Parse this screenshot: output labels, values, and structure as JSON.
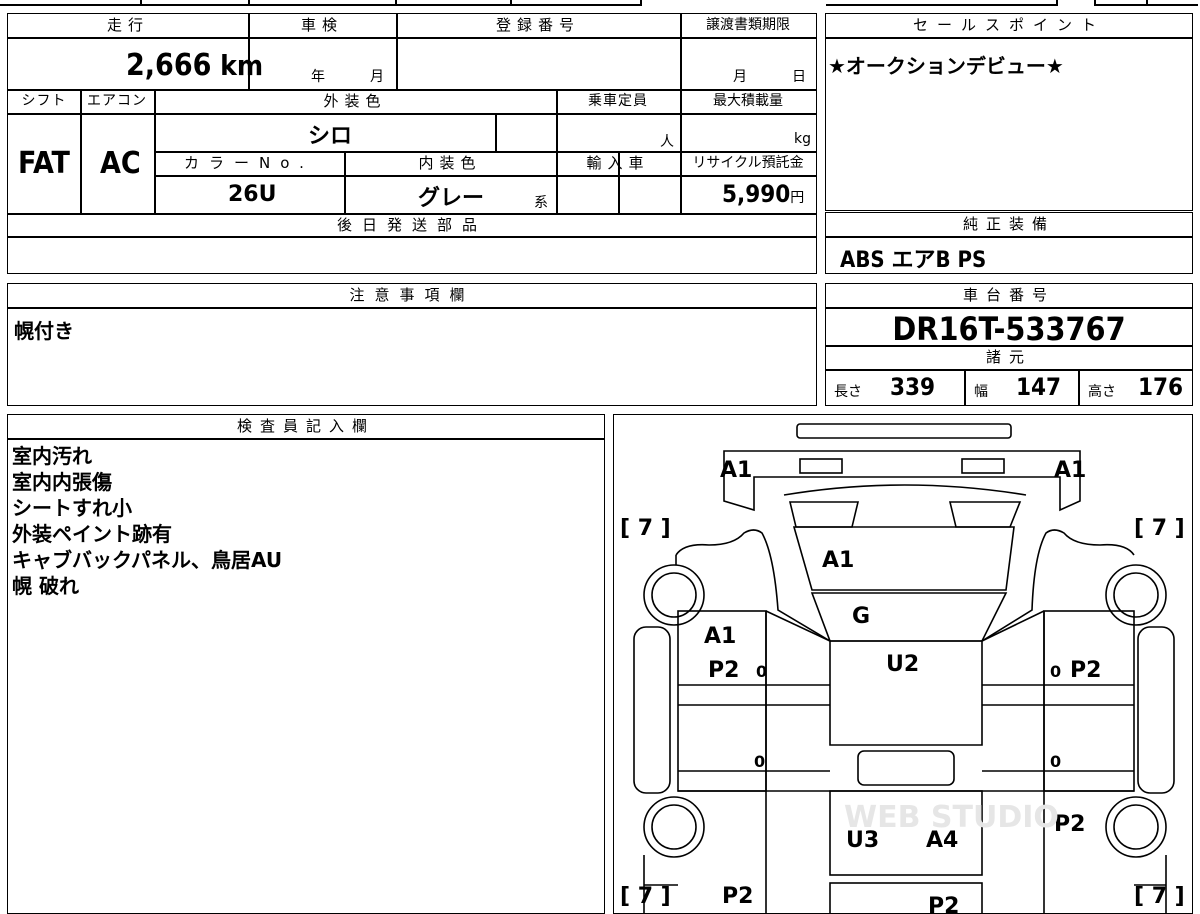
{
  "top_strip": {},
  "mileage": {
    "label": "走行",
    "value": "2,666",
    "unit": "km"
  },
  "inspection": {
    "label": "車検",
    "year": "年",
    "month": "月"
  },
  "registration": {
    "label": "登録番号",
    "value": ""
  },
  "transfer_deadline": {
    "label": "譲渡書類期限",
    "month": "月",
    "day": "日"
  },
  "sales_point": {
    "label": "セールスポイント",
    "text": "★オークションデビュー★"
  },
  "shift": {
    "label": "シフト",
    "value": "FAT"
  },
  "aircon": {
    "label": "エアコン",
    "value": "AC"
  },
  "exterior_color": {
    "label": "外装色",
    "value": "シロ"
  },
  "capacity": {
    "label": "乗車定員",
    "unit": "人"
  },
  "max_load": {
    "label": "最大積載量",
    "unit": "kg"
  },
  "color_no": {
    "label": "カラーNo.",
    "value": "26U"
  },
  "interior_color": {
    "label": "内装色",
    "value": "グレー",
    "suffix": "系"
  },
  "import": {
    "label": "輸入車"
  },
  "recycle_fee": {
    "label": "リサイクル預託金",
    "value": "5,990",
    "unit": "円"
  },
  "later_parts": {
    "label": "後日発送部品",
    "value": ""
  },
  "factory_equipment": {
    "label": "純正装備",
    "value": "ABS エアB PS"
  },
  "notes": {
    "label": "注意事項欄",
    "text": "幌付き"
  },
  "chassis": {
    "label": "車台番号",
    "value": "DR16T-533767"
  },
  "specs": {
    "label": "諸元",
    "length_label": "長さ",
    "length": "339",
    "width_label": "幅",
    "width": "147",
    "height_label": "高さ",
    "height": "176"
  },
  "inspector": {
    "label": "検査員記入欄",
    "lines": [
      "室内汚れ",
      "室内内張傷",
      "シートすれ小",
      "外装ペイント跡有",
      "キャブバックパネル、鳥居AU",
      "幌 破れ"
    ]
  },
  "diagram": {
    "marks": [
      {
        "id": "front-left-corner",
        "text": "A1"
      },
      {
        "id": "front-right-corner",
        "text": "A1"
      },
      {
        "id": "hood",
        "text": "A1"
      },
      {
        "id": "windshield",
        "text": "G"
      },
      {
        "id": "roof",
        "text": "U2"
      },
      {
        "id": "left-door",
        "text": "A1"
      },
      {
        "id": "left-door-2",
        "text": "P2"
      },
      {
        "id": "right-door",
        "text": "P2"
      },
      {
        "id": "bed-floor-1",
        "text": "U3"
      },
      {
        "id": "bed-floor-2",
        "text": "A4"
      },
      {
        "id": "rear-right",
        "text": "P2"
      },
      {
        "id": "rear-left",
        "text": "P2"
      },
      {
        "id": "rear-bottom",
        "text": "P2"
      }
    ],
    "brackets": [
      "[ 7 ]",
      "[ 7 ]",
      "[ 7 ]",
      "[ 7 ]"
    ],
    "zeros": [
      "0",
      "0",
      "0",
      "0"
    ],
    "watermark": "WEB STUDIO"
  }
}
